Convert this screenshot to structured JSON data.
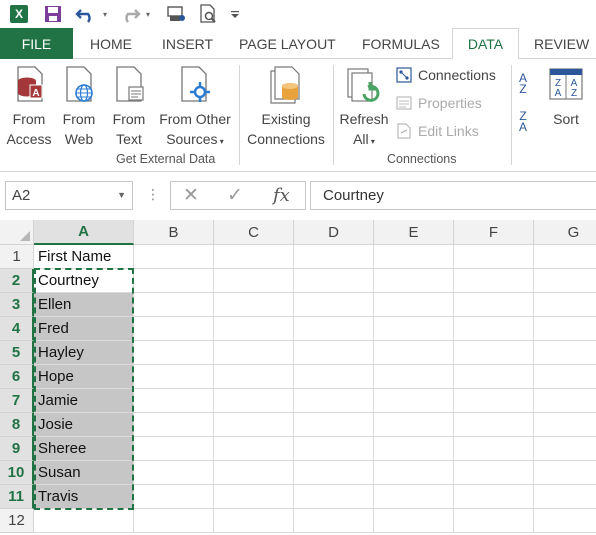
{
  "quick_access": {
    "icons": [
      "excel-logo",
      "save-icon",
      "undo-icon",
      "redo-icon",
      "touch-mode-icon",
      "print-preview-icon",
      "customize-qat-icon"
    ],
    "logo_letter": "X"
  },
  "tabs": {
    "file": "FILE",
    "home": "HOME",
    "insert": "INSERT",
    "page_layout": "PAGE LAYOUT",
    "formulas": "FORMULAS",
    "data": "DATA",
    "review": "REVIEW",
    "active": "DATA"
  },
  "ribbon": {
    "get_external_data": {
      "label": "Get External Data",
      "from_access": [
        "From",
        "Access"
      ],
      "from_web": [
        "From",
        "Web"
      ],
      "from_text": [
        "From",
        "Text"
      ],
      "from_other": [
        "From Other",
        "Sources"
      ],
      "existing": [
        "Existing",
        "Connections"
      ]
    },
    "connections": {
      "label": "Connections",
      "refresh": [
        "Refresh",
        "All"
      ],
      "connections_btn": "Connections",
      "properties_btn": "Properties",
      "edit_links_btn": "Edit Links"
    },
    "sort": {
      "sort_btn": "Sort",
      "az_top": "A",
      "az_bottom": "Z",
      "za_top": "Z",
      "za_bottom": "A"
    }
  },
  "formula_bar": {
    "name_box": "A2",
    "fx": "fx",
    "formula": "Courtney"
  },
  "columns": [
    "A",
    "B",
    "C",
    "D",
    "E",
    "F",
    "G"
  ],
  "rows": [
    "1",
    "2",
    "3",
    "4",
    "5",
    "6",
    "7",
    "8",
    "9",
    "10",
    "11",
    "12"
  ],
  "cells_A": [
    "First Name",
    "Courtney",
    "Ellen",
    "Fred",
    "Hayley",
    "Hope",
    "Jamie",
    "Josie",
    "Sheree",
    "Susan",
    "Travis",
    ""
  ],
  "colors": {
    "accent": "#217346",
    "selection_fill": "#c6c6c6",
    "marquee": "#217346"
  }
}
